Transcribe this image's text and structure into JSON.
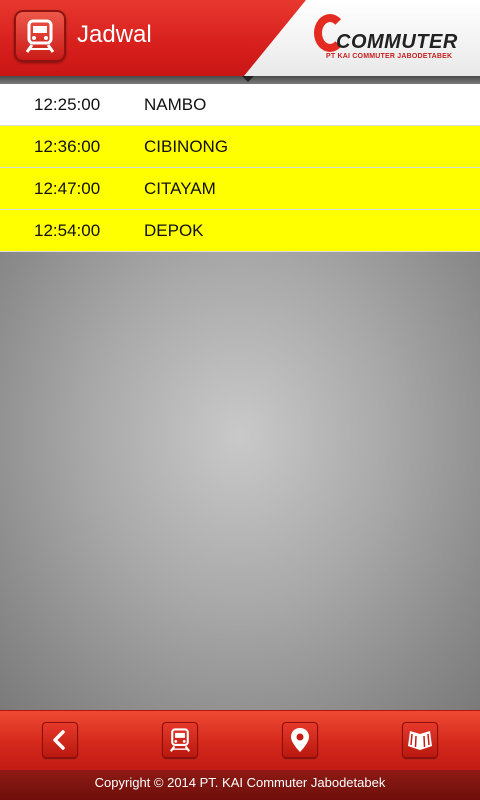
{
  "header": {
    "title": "Jadwal",
    "app_icon": "train-icon",
    "logo": {
      "word": "COMMUTER",
      "sub": "PT KAI COMMUTER JABODETABEK"
    }
  },
  "schedule": [
    {
      "time": "12:25:00",
      "station": "NAMBO",
      "highlighted": false
    },
    {
      "time": "12:36:00",
      "station": "CIBINONG",
      "highlighted": true
    },
    {
      "time": "12:47:00",
      "station": "CITAYAM",
      "highlighted": true
    },
    {
      "time": "12:54:00",
      "station": "DEPOK",
      "highlighted": true
    }
  ],
  "bottom_nav": {
    "buttons": [
      "back-icon",
      "train-icon",
      "location-pin-icon",
      "map-book-icon"
    ]
  },
  "footer": {
    "copyright": "Copyright © 2014 PT. KAI Commuter Jabodetabek"
  },
  "colors": {
    "accent": "#d71f1c",
    "highlight": "#ffff00"
  }
}
